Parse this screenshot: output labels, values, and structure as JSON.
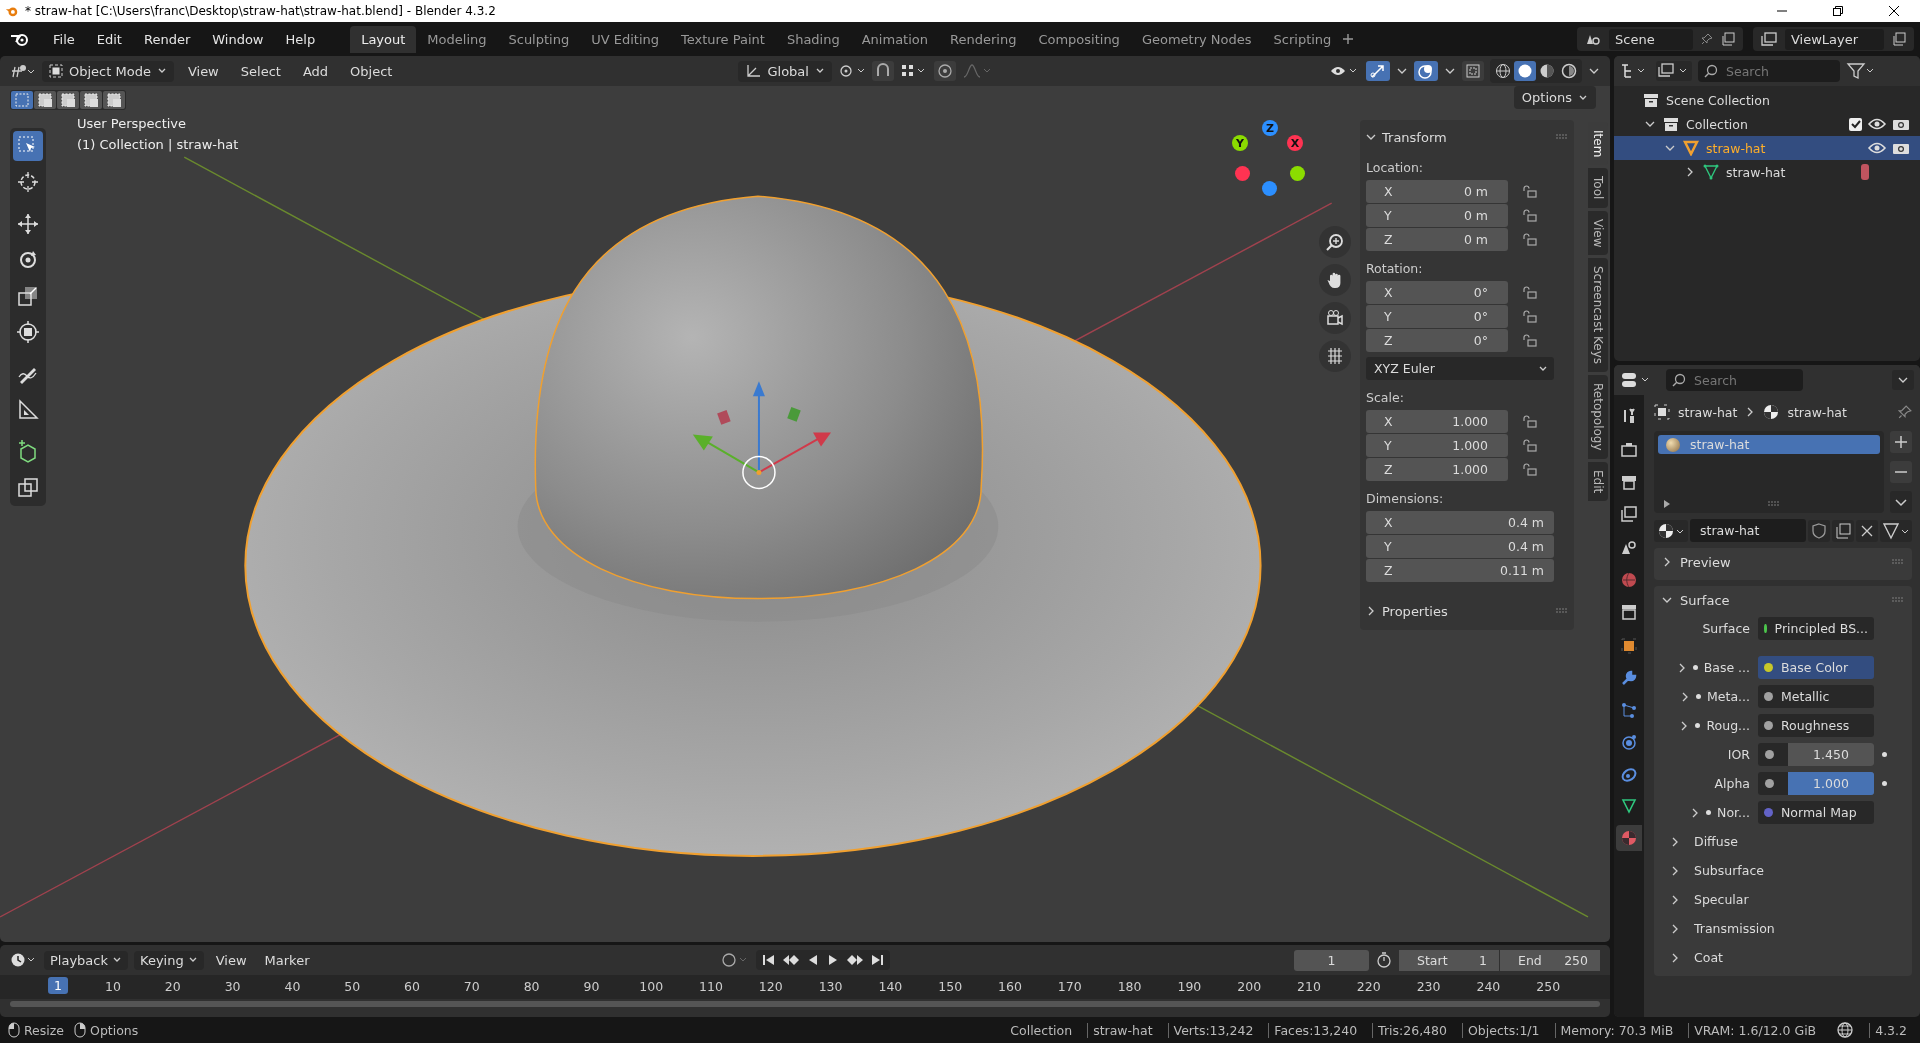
{
  "window": {
    "title": "* straw-hat [C:\\Users\\franc\\Desktop\\straw-hat\\straw-hat.blend] - Blender 4.3.2"
  },
  "menu": [
    "File",
    "Edit",
    "Render",
    "Window",
    "Help"
  ],
  "workspaces": [
    {
      "label": "Layout",
      "selected": true
    },
    {
      "label": "Modeling",
      "selected": false
    },
    {
      "label": "Sculpting",
      "selected": false
    },
    {
      "label": "UV Editing",
      "selected": false
    },
    {
      "label": "Texture Paint",
      "selected": false
    },
    {
      "label": "Shading",
      "selected": false
    },
    {
      "label": "Animation",
      "selected": false
    },
    {
      "label": "Rendering",
      "selected": false
    },
    {
      "label": "Compositing",
      "selected": false
    },
    {
      "label": "Geometry Nodes",
      "selected": false
    },
    {
      "label": "Scripting",
      "selected": false
    }
  ],
  "scene": "Scene",
  "view_layer": "ViewLayer",
  "viewport_header": {
    "mode": "Object Mode",
    "menus": [
      "View",
      "Select",
      "Add",
      "Object"
    ],
    "orientation": "Global",
    "shading": [
      {
        "kind": "wireframe",
        "selected": false
      },
      {
        "kind": "solid",
        "selected": true
      },
      {
        "kind": "material",
        "selected": false
      },
      {
        "kind": "rendered",
        "selected": false
      }
    ]
  },
  "select_modes": [
    {
      "kind": "set",
      "selected": true
    },
    {
      "kind": "extend",
      "selected": false
    },
    {
      "kind": "subtract",
      "selected": false
    },
    {
      "kind": "invert",
      "selected": false
    },
    {
      "kind": "intersect",
      "selected": false
    }
  ],
  "viewport": {
    "perspective": "User Perspective",
    "context": "(1) Collection | straw-hat",
    "options": "Options",
    "axes": [
      {
        "label": "Y",
        "color": "#8bdc00",
        "kind": "positive"
      },
      {
        "label": "Z",
        "color": "#2c8fff",
        "kind": "positive"
      },
      {
        "label": "X",
        "color": "#ff3352",
        "kind": "positive"
      },
      {
        "color": "#ff3352",
        "kind": "negative"
      },
      {
        "color": "#2c8fff",
        "kind": "negative"
      },
      {
        "color": "#8bdc00",
        "kind": "negative"
      }
    ]
  },
  "tools": [
    {
      "kind": "select",
      "selected": true
    },
    {
      "kind": "cursor",
      "selected": false
    },
    {
      "kind": "move",
      "selected": false
    },
    {
      "kind": "rotate",
      "selected": false
    },
    {
      "kind": "scale",
      "selected": false
    },
    {
      "kind": "transform",
      "selected": false
    },
    {
      "kind": "annotate",
      "selected": false
    },
    {
      "kind": "measure",
      "selected": false
    },
    {
      "kind": "add-cube",
      "selected": false
    },
    {
      "kind": "duplicate",
      "selected": false
    }
  ],
  "nav_controls": [
    {
      "kind": "zoom"
    },
    {
      "kind": "pan"
    },
    {
      "kind": "camera"
    },
    {
      "kind": "grid"
    }
  ],
  "transform": {
    "title": "Transform",
    "expanded": true,
    "groups": [
      {
        "label": "Location:",
        "fields": [
          {
            "axis": "X",
            "value": "0 m",
            "locked": false
          },
          {
            "axis": "Y",
            "value": "0 m",
            "locked": false
          },
          {
            "axis": "Z",
            "value": "0 m",
            "locked": false
          }
        ]
      },
      {
        "label": "Rotation:",
        "fields": [
          {
            "axis": "X",
            "value": "0°",
            "locked": false
          },
          {
            "axis": "Y",
            "value": "0°",
            "locked": false
          },
          {
            "axis": "Z",
            "value": "0°",
            "locked": false
          }
        ],
        "mode": "XYZ Euler"
      },
      {
        "label": "Scale:",
        "fields": [
          {
            "axis": "X",
            "value": "1.000",
            "locked": false
          },
          {
            "axis": "Y",
            "value": "1.000",
            "locked": false
          },
          {
            "axis": "Z",
            "value": "1.000",
            "locked": false
          }
        ]
      },
      {
        "label": "Dimensions:",
        "fields": [
          {
            "axis": "X",
            "value": "0.4 m"
          },
          {
            "axis": "Y",
            "value": "0.4 m"
          },
          {
            "axis": "Z",
            "value": "0.11 m"
          }
        ]
      }
    ]
  },
  "properties_panel": {
    "title": "Properties",
    "expanded": false
  },
  "sidebar_tabs": [
    {
      "label": "Item",
      "selected": true
    },
    {
      "label": "Tool",
      "selected": false
    },
    {
      "label": "View",
      "selected": false
    },
    {
      "label": "Screencast Keys",
      "selected": false
    },
    {
      "label": "Retopology",
      "selected": false
    },
    {
      "label": "Edit",
      "selected": false
    }
  ],
  "outliner": {
    "search_placeholder": "Search",
    "tree": [
      {
        "label": "Scene Collection",
        "kind": "scene",
        "children": [
          {
            "label": "Collection",
            "kind": "collection",
            "expanded": true,
            "checked": true,
            "children": [
              {
                "label": "straw-hat",
                "kind": "object",
                "expanded": true,
                "selected": true,
                "children": [
                  {
                    "label": "straw-hat",
                    "kind": "mesh",
                    "expanded": false,
                    "selected": false
                  }
                ]
              }
            ]
          }
        ]
      }
    ]
  },
  "properties": {
    "search_placeholder": "Search",
    "tabs": [
      {
        "kind": "tool",
        "selected": false
      },
      {
        "kind": "render",
        "selected": false
      },
      {
        "kind": "output",
        "selected": false
      },
      {
        "kind": "view-layer",
        "selected": false
      },
      {
        "kind": "scene",
        "selected": false
      },
      {
        "kind": "world",
        "selected": false
      },
      {
        "kind": "collection",
        "selected": false
      },
      {
        "kind": "object",
        "selected": false
      },
      {
        "kind": "modifier",
        "selected": false
      },
      {
        "kind": "particles",
        "selected": false
      },
      {
        "kind": "physics",
        "selected": false
      },
      {
        "kind": "constraint",
        "selected": false
      },
      {
        "kind": "data",
        "selected": false
      },
      {
        "kind": "material",
        "selected": true
      }
    ],
    "breadcrumb": [
      "straw-hat",
      "straw-hat"
    ],
    "material_slots": [
      {
        "label": "straw-hat",
        "selected": true
      }
    ],
    "material_name": "straw-hat",
    "panels": [
      {
        "title": "Preview",
        "expanded": false
      },
      {
        "title": "Surface",
        "expanded": true,
        "rows": [
          {
            "kind": "shader",
            "label": "Surface",
            "value": "Principled BS...",
            "color": "#4cc54c"
          },
          {
            "kind": "link",
            "label": "Base ...",
            "value": "Base Color",
            "color": "#c7c729",
            "highlighted": true
          },
          {
            "kind": "link",
            "label": "Meta...",
            "value": "Metallic",
            "color": "#a1a1a1",
            "highlighted": false
          },
          {
            "kind": "link",
            "label": "Roug...",
            "value": "Roughness",
            "color": "#a1a1a1",
            "highlighted": false
          },
          {
            "kind": "number",
            "label": "IOR",
            "value": "1.450",
            "color": "#a1a1a1"
          },
          {
            "kind": "slider",
            "label": "Alpha",
            "value": "1.000",
            "level": 1,
            "color": "#a1a1a1"
          },
          {
            "kind": "link",
            "label": "Nor...",
            "value": "Normal Map",
            "color": "#6363c7",
            "highlighted": false
          }
        ],
        "subpanels": [
          {
            "title": "Diffuse",
            "expanded": false
          },
          {
            "title": "Subsurface",
            "expanded": false
          },
          {
            "title": "Specular",
            "expanded": false
          },
          {
            "title": "Transmission",
            "expanded": false
          },
          {
            "title": "Coat",
            "expanded": false
          }
        ]
      }
    ]
  },
  "timeline": {
    "menus": [
      "Playback",
      "Keying",
      "View",
      "Marker"
    ],
    "current_frame": "1",
    "start_label": "Start",
    "start": "1",
    "end_label": "End",
    "end": "250",
    "ruler": [
      {
        "label": "1",
        "selected": true
      },
      {
        "label": "10",
        "selected": false
      },
      {
        "label": "20",
        "selected": false
      },
      {
        "label": "30",
        "selected": false
      },
      {
        "label": "40",
        "selected": false
      },
      {
        "label": "50",
        "selected": false
      },
      {
        "label": "60",
        "selected": false
      },
      {
        "label": "70",
        "selected": false
      },
      {
        "label": "80",
        "selected": false
      },
      {
        "label": "90",
        "selected": false
      },
      {
        "label": "100",
        "selected": false
      },
      {
        "label": "110",
        "selected": false
      },
      {
        "label": "120",
        "selected": false
      },
      {
        "label": "130",
        "selected": false
      },
      {
        "label": "140",
        "selected": false
      },
      {
        "label": "150",
        "selected": false
      },
      {
        "label": "160",
        "selected": false
      },
      {
        "label": "170",
        "selected": false
      },
      {
        "label": "180",
        "selected": false
      },
      {
        "label": "190",
        "selected": false
      },
      {
        "label": "200",
        "selected": false
      },
      {
        "label": "210",
        "selected": false
      },
      {
        "label": "220",
        "selected": false
      },
      {
        "label": "230",
        "selected": false
      },
      {
        "label": "240",
        "selected": false
      },
      {
        "label": "250",
        "selected": false
      }
    ]
  },
  "status_bar": {
    "hints": [
      {
        "kind": "mouse-left",
        "label": "Resize"
      },
      {
        "kind": "mouse-right",
        "label": "Options"
      }
    ],
    "stats": [
      "Collection",
      "straw-hat",
      "Verts:13,242",
      "Faces:13,240",
      "Tris:26,480",
      "Objects:1/1",
      "Memory: 70.3 MiB",
      "VRAM: 1.6/12.0 GiB"
    ],
    "version": "4.3.2"
  }
}
